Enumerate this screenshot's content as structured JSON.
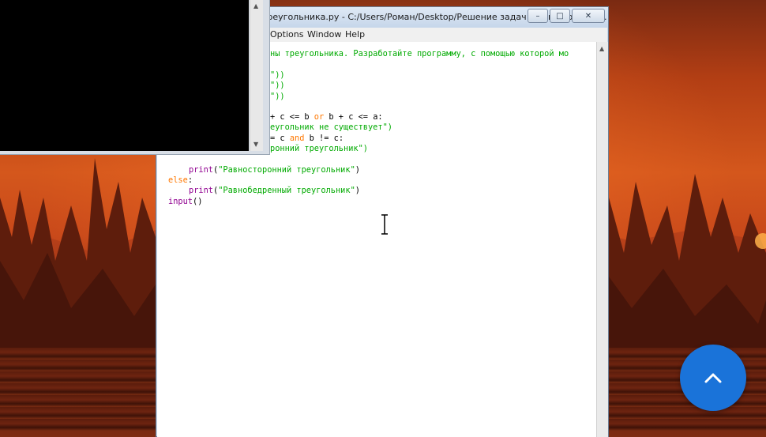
{
  "window": {
    "title": "треугольника.py - C:/Users/Роман/Desktop/Решение задач на тип треугол...",
    "caption": {
      "minimize": "–",
      "maximize": "□",
      "close": "✕"
    }
  },
  "menu": {
    "items": [
      {
        "label": "Options"
      },
      {
        "label": "Window"
      },
      {
        "label": "Help"
      }
    ]
  },
  "code": {
    "line1": "ны треугольника. Разработайте программу, с помощью которой мо",
    "line2": "\"))",
    "line3": "\"))",
    "line4": "\"))",
    "line5_a": "+ c <= b ",
    "line5_or": "or",
    "line5_b": " b + c <= a:",
    "line6": "еугольник не существует\")",
    "line7_a": "= c ",
    "line7_and": "and",
    "line7_b": " b != c:",
    "line8": "ронний треугольник\")",
    "line9_fn": "print",
    "line9_p1": "(",
    "line9_str": "\"Равносторонний треугольник\"",
    "line9_p2": ")",
    "line10": "else",
    "line10_colon": ":",
    "line11_fn": "print",
    "line11_p1": "(",
    "line11_str": "\"Равнобедренный треугольник\"",
    "line11_p2": ")",
    "line12_fn": "input",
    "line12_p": "()"
  },
  "icons": {
    "cursor": "text-cursor-icon",
    "scroll_top": "chevron-up-icon"
  },
  "colors": {
    "keyword": "#ff7700",
    "string": "#00aa00",
    "builtin": "#900090",
    "scroll_button": "#1a73d9"
  }
}
